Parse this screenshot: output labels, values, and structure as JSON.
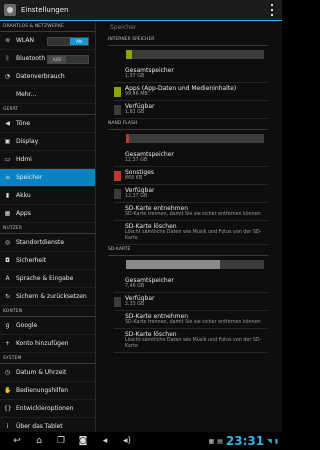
{
  "actionbar": {
    "title": "Einstellungen"
  },
  "left": {
    "sections": [
      {
        "title": "DRAHTLOS & NETZWERKE",
        "items": [
          {
            "icon": "wifi-icon",
            "glyph": "≋",
            "label": "WLAN",
            "toggle": "on",
            "toggle_text": "AN"
          },
          {
            "icon": "bluetooth-icon",
            "glyph": "ᛒ",
            "label": "Bluetooth",
            "toggle": "off",
            "toggle_text": "AUS"
          },
          {
            "icon": "data-usage-icon",
            "glyph": "◔",
            "label": "Datenverbrauch"
          },
          {
            "icon": "",
            "glyph": "",
            "label": "Mehr..."
          }
        ]
      },
      {
        "title": "GERÄT",
        "items": [
          {
            "icon": "sound-icon",
            "glyph": "◀",
            "label": "Töne"
          },
          {
            "icon": "display-icon",
            "glyph": "▣",
            "label": "Display"
          },
          {
            "icon": "hdmi-icon",
            "glyph": "▭",
            "label": "Hdmi"
          },
          {
            "icon": "storage-icon",
            "glyph": "≡",
            "label": "Speicher",
            "active": true
          },
          {
            "icon": "battery-icon",
            "glyph": "▮",
            "label": "Akku"
          },
          {
            "icon": "apps-icon",
            "glyph": "▦",
            "label": "Apps"
          }
        ]
      },
      {
        "title": "NUTZER",
        "items": [
          {
            "icon": "location-icon",
            "glyph": "◎",
            "label": "Standortdienste"
          },
          {
            "icon": "lock-icon",
            "glyph": "◘",
            "label": "Sicherheit"
          },
          {
            "icon": "language-icon",
            "glyph": "A",
            "label": "Sprache & Eingabe"
          },
          {
            "icon": "backup-icon",
            "glyph": "↻",
            "label": "Sichern & zurücksetzen"
          }
        ]
      },
      {
        "title": "KONTEN",
        "items": [
          {
            "icon": "google-icon",
            "glyph": "g",
            "label": "Google"
          },
          {
            "icon": "add-account-icon",
            "glyph": "+",
            "label": "Konto hinzufügen"
          }
        ]
      },
      {
        "title": "SYSTEM",
        "items": [
          {
            "icon": "clock-icon",
            "glyph": "◷",
            "label": "Datum & Uhrzeit"
          },
          {
            "icon": "accessibility-icon",
            "glyph": "✋",
            "label": "Bedienungshilfen"
          },
          {
            "icon": "developer-icon",
            "glyph": "{}",
            "label": "Entwickleroptionen"
          },
          {
            "icon": "info-icon",
            "glyph": "i",
            "label": "Über das Tablet"
          }
        ]
      }
    ]
  },
  "right": {
    "title": "Speicher",
    "internal": {
      "title": "INTERNER SPEICHER",
      "bar": [
        {
          "color": "#8aa400",
          "fraction": 0.04
        }
      ],
      "rows": [
        {
          "label": "Gesamtspeicher",
          "value": "1,97 GB"
        },
        {
          "label": "Apps (App-Daten und Medieninhalte)",
          "value": "99,46 MB",
          "color": "#8aa400"
        },
        {
          "label": "Verfügbar",
          "value": "1,82 GB",
          "color": "#3b3b3b"
        }
      ]
    },
    "nand": {
      "title": "NAND FLASH",
      "bar": [
        {
          "color": "#c0392b",
          "fraction": 0.01
        }
      ],
      "rows": [
        {
          "label": "Gesamtspeicher",
          "value": "12,37 GB"
        },
        {
          "label": "Sonstiges",
          "value": "868 KB",
          "color": "#c0392b"
        },
        {
          "label": "Verfügbar",
          "value": "12,37 GB",
          "color": "#3b3b3b"
        },
        {
          "label": "SD-Karte entnehmen",
          "value": "SD-Karte trennen, damit Sie sie sicher entfernen können"
        },
        {
          "label": "SD-Karte löschen",
          "value": "Löscht sämtliche Daten wie Musik und Fotos von der SD-Karte"
        }
      ]
    },
    "sd": {
      "title": "SD-KARTE",
      "bar": [
        {
          "color": "#8a8a8a",
          "fraction": 0.68
        }
      ],
      "rows": [
        {
          "label": "Gesamtspeicher",
          "value": "7,46 GB"
        },
        {
          "label": "Verfügbar",
          "value": "2,33 GB",
          "color": "#3b3b3b"
        },
        {
          "label": "SD-Karte entnehmen",
          "value": "SD-Karte trennen, damit Sie sie sicher entfernen können"
        },
        {
          "label": "SD-Karte löschen",
          "value": "Löscht sämtliche Daten wie Musik und Fotos von der SD-Karte"
        }
      ]
    }
  },
  "navbar": {
    "clock": "23:31",
    "items": [
      "back-icon",
      "home-icon",
      "recent-apps-icon",
      "camera-icon",
      "volume-down-icon",
      "volume-up-icon"
    ]
  }
}
